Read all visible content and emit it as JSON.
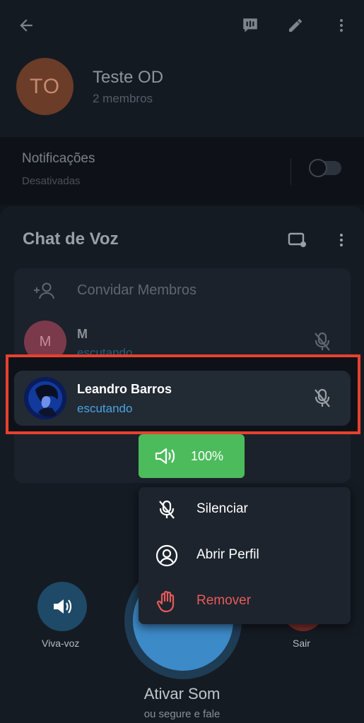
{
  "header": {
    "title": "Teste OD",
    "subtitle": "2 membros",
    "avatar_initials": "TO",
    "avatar_color": "#6b3c28"
  },
  "notifications": {
    "title": "Notificações",
    "status": "Desativadas",
    "enabled": false
  },
  "voice_chat": {
    "title": "Chat de Voz",
    "invite_label": "Convidar Membros",
    "participants": [
      {
        "name": "M",
        "initials": "M",
        "status": "escutando",
        "muted": true
      },
      {
        "name": "Leandro Barros",
        "status": "escutando",
        "muted": true
      }
    ],
    "volume_label": "100%",
    "volume_level": 0.5
  },
  "context_menu": {
    "items": [
      {
        "label": "Silenciar",
        "icon": "mic-off-icon"
      },
      {
        "label": "Abrir Perfil",
        "icon": "profile-icon"
      },
      {
        "label": "Remover",
        "icon": "hand-icon",
        "color": "#e85a5a"
      }
    ]
  },
  "controls": {
    "speaker_label": "Viva-voz",
    "leave_label": "Sair",
    "unmute_label": "Ativar Som",
    "unmute_hint": "ou segure e fale"
  },
  "colors": {
    "accent": "#4aa3e0",
    "volume": "#4cbb5c",
    "highlight": "#e8412e",
    "danger": "#e85a5a"
  }
}
